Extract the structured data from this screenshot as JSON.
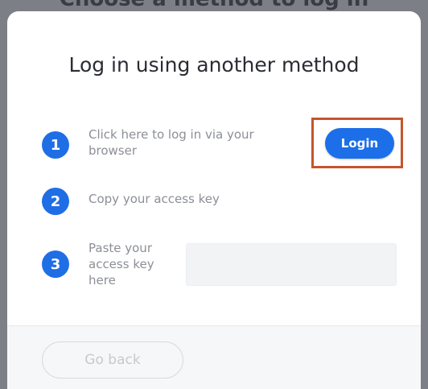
{
  "background": {
    "title_partial": "Choose a method to log in"
  },
  "modal": {
    "title": "Log in using another method",
    "steps": [
      {
        "number": "1",
        "text": "Click here to log in via your browser"
      },
      {
        "number": "2",
        "text": "Copy your access key"
      },
      {
        "number": "3",
        "text": "Paste your access key here"
      }
    ],
    "login_button_label": "Login",
    "access_key_value": "",
    "back_button_label": "Go back"
  },
  "colors": {
    "accent": "#1f6ee6",
    "highlight": "#c5552d"
  }
}
